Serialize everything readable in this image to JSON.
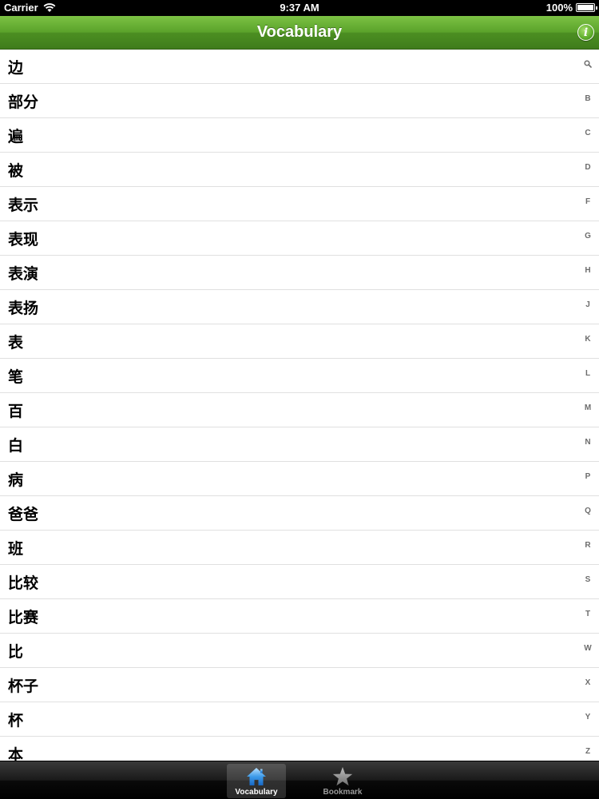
{
  "status_bar": {
    "carrier": "Carrier",
    "time": "9:37 AM",
    "battery": "100%",
    "battery_level": 1.0
  },
  "nav": {
    "title": "Vocabulary",
    "info_icon": "info-icon",
    "info_glyph": "i"
  },
  "colors": {
    "nav_green": "#5aa22a",
    "tab_selected_blue": "#3d9be9"
  },
  "vocabulary": [
    "边",
    "部分",
    "遍",
    "被",
    "表示",
    "表现",
    "表演",
    "表扬",
    "表",
    "笔",
    "百",
    "白",
    "病",
    "爸爸",
    "班",
    "比较",
    "比赛",
    "比",
    "杯子",
    "杯",
    "本"
  ],
  "section_index": [
    "B",
    "C",
    "D",
    "F",
    "G",
    "H",
    "J",
    "K",
    "L",
    "M",
    "N",
    "P",
    "Q",
    "R",
    "S",
    "T",
    "W",
    "X",
    "Y",
    "Z"
  ],
  "tabs": [
    {
      "label": "Vocabulary",
      "icon": "home-icon",
      "selected": true
    },
    {
      "label": "Bookmark",
      "icon": "star-icon",
      "selected": false
    }
  ]
}
